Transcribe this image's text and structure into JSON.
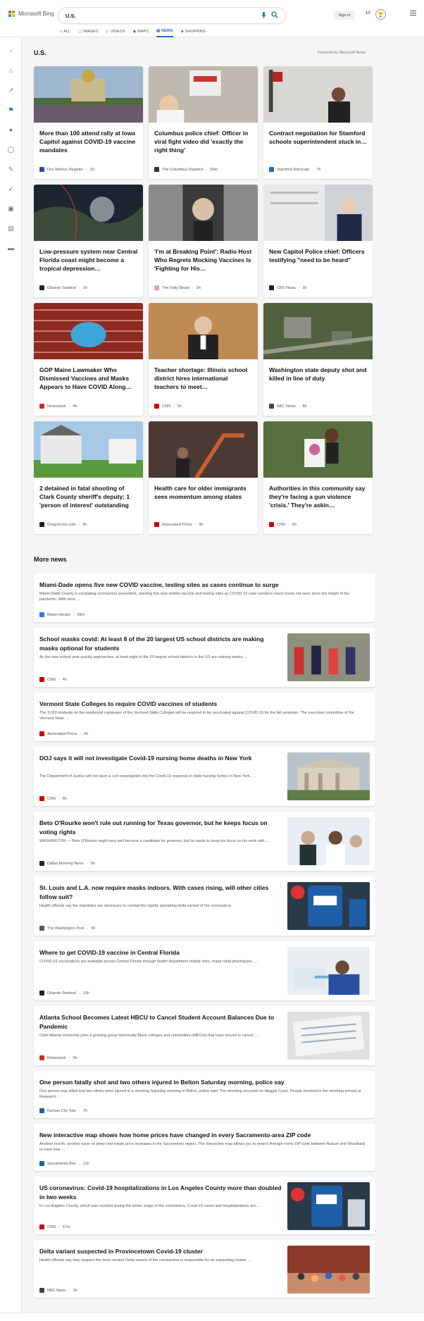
{
  "header": {
    "brand": "Microsoft Bing",
    "search_value": "U.S.",
    "signin_label": "Sign in",
    "points": "10"
  },
  "tabs": [
    {
      "label": "ALL",
      "icon": "search-icon"
    },
    {
      "label": "IMAGES",
      "icon": "image-icon"
    },
    {
      "label": "VIDEOS",
      "icon": "video-icon"
    },
    {
      "label": "MAPS",
      "icon": "map-pin-icon"
    },
    {
      "label": "NEWS",
      "icon": "news-icon",
      "active": true
    },
    {
      "label": "SHOPPING",
      "icon": "tag-icon"
    }
  ],
  "section": {
    "title": "U.S.",
    "powered": "Powered by Microsoft News"
  },
  "cards": [
    {
      "title": "More than 100 attend rally at Iowa Capitol against COVID-19 vaccine mandates",
      "source": "Des Moines Register",
      "time": "1h",
      "badge_color": "#2b4f9e"
    },
    {
      "title": "Columbus police chief: Officer in viral fight video did 'exactly the right thing'",
      "source": "The Columbus Dispatch",
      "time": "56m",
      "badge_color": "#333333"
    },
    {
      "title": "Contract negotiation for Stamford schools superintendent stuck in…",
      "source": "Stamford Advocate",
      "time": "7h",
      "badge_color": "#1f6fb5"
    },
    {
      "title": "Low-pressure system near Central Florida coast might become a tropical depression…",
      "source": "Orlando Sentinel",
      "time": "1h",
      "badge_color": "#222222"
    },
    {
      "title": "'I'm at Breaking Point': Radio Host Who Regrets Mocking Vaccines Is 'Fighting for His…",
      "source": "The Daily Beast",
      "time": "3h",
      "badge_color": "#e8a0b0"
    },
    {
      "title": "New Capitol Police chief: Officers testifying \"need to be heard\"",
      "source": "CBS News",
      "time": "3h",
      "badge_color": "#222222"
    },
    {
      "title": "GOP Maine Lawmaker Who Dismissed Vaccines and Masks Appears to Have COVID Along…",
      "source": "Newsweek",
      "time": "4h",
      "badge_color": "#d42b2b"
    },
    {
      "title": "Teacher shortage: Illinois school district hires international teachers to meet…",
      "source": "CNN",
      "time": "5h",
      "badge_color": "#cc0000"
    },
    {
      "title": "Washington state deputy shot and killed in line of duty",
      "source": "ABC News",
      "time": "8h",
      "badge_color": "#444444"
    },
    {
      "title": "2 detained in fatal shooting of Clark County sheriff's deputy; 1 'person of interest' outstanding",
      "source": "OregonLive.com",
      "time": "3h",
      "badge_color": "#222222"
    },
    {
      "title": "Health care for older immigrants sees momentum among states",
      "source": "Associated Press",
      "time": "9h",
      "badge_color": "#cc0000"
    },
    {
      "title": "Authorities in this community say they're facing a gun violence 'crisis.' They're askin…",
      "source": "CNN",
      "time": "9h",
      "badge_color": "#cc0000"
    }
  ],
  "more_news_title": "More news",
  "more_news": [
    {
      "title": "Miami-Dade opens five new COVID vaccine, testing sites as cases continue to surge",
      "snippet": "Miami-Dade County is escalating coronavirus prevention, opening five new mobile vaccine and testing sites as COVID-19 case numbers reach levels not seen since the height of the pandemic. With virus …",
      "source": "Miami Herald",
      "time": "28m",
      "badge_color": "#2b7bd6",
      "has_thumb": false
    },
    {
      "title": "School masks covid: At least 8 of the 20 largest US school districts are making masks optional for students",
      "snippet": "As the new school year quickly approaches, at least eight of the 20 largest school districts in the US are making masks …",
      "source": "CNN",
      "time": "4h",
      "badge_color": "#cc0000",
      "has_thumb": true
    },
    {
      "title": "Vermont State Colleges to require COVID vaccines of students",
      "snippet": "The 3,000 students on the residential campuses of the Vermont State Colleges will be required to be vaccinated against COVID-19 for the fall semester. The executive committee of the Vermont State …",
      "source": "Associated Press",
      "time": "5h",
      "badge_color": "#cc0000",
      "has_thumb": false
    },
    {
      "title": "DOJ says it will not investigate Covid-19 nursing home deaths in New York",
      "snippet": "The Department of Justice will not open a civil investigation into the Covid-19 response in state nursing homes in New York, …",
      "source": "CNN",
      "time": "8h",
      "badge_color": "#cc0000",
      "has_thumb": true
    },
    {
      "title": "Beto O'Rourke won't rule out running for Texas governor, but he keeps focus on voting rights",
      "snippet": "WASHINGTON — Beto O'Rourke might very well become a candidate for governor, but he wants to keep his focus on his work with …",
      "source": "Dallas Morning News",
      "time": "6h",
      "badge_color": "#222222",
      "has_thumb": true
    },
    {
      "title": "St. Louis and L.A. now require masks indoors. With cases rising, will other cities follow suit?",
      "snippet": "Health officials say the mandates are necessary to combat the rapidly spreading delta variant of the coronavirus.",
      "source": "The Washington Post",
      "time": "5h",
      "badge_color": "#555555",
      "has_thumb": true
    },
    {
      "title": "Where to get COVID-19 vaccine in Central Florida",
      "snippet": "COVID-19 vaccinations are available across Central Florida through health department mobile sites, major retail pharmacies, …",
      "source": "Orlando Sentinel",
      "time": "10h",
      "badge_color": "#222222",
      "has_thumb": true
    },
    {
      "title": "Atlanta School Becomes Latest HBCU to Cancel Student Account Balances Due to Pandemic",
      "snippet": "Clark Atlanta University joins a growing group historically Black colleges and universities (HBCUs) that have moved to cancel …",
      "source": "Newsweek",
      "time": "5h",
      "badge_color": "#d42b2b",
      "has_thumb": true
    },
    {
      "title": "One person fatally shot and two others injured in Belton Saturday morning, police say",
      "snippet": "One person was killed and two others were injured in a shooting Saturday morning in Belton, police said. The shooting occurred on Maggie Court. People involved in the shooting arrived at Research …",
      "source": "Kansas City Star",
      "time": "7h",
      "badge_color": "#1f5fa8",
      "has_thumb": false
    },
    {
      "title": "New interactive map shows how home prices have changed in every Sacramento-area ZIP code",
      "snippet": "Another month, another wave of steep real estate price increases in the Sacramento region. This interactive map allows you to search through every ZIP code between Auburn and Woodland to track how …",
      "source": "Sacramento Bee",
      "time": "11h",
      "badge_color": "#1f5fa8",
      "has_thumb": false
    },
    {
      "title": "US coronavirus: Covid-19 hospitalizations in Los Angeles County more than doubled in two weeks",
      "snippet": "In Los Angeles County, which was crushed during the winter surge of the coronavirus, Covid-19 cases and hospitalizations are …",
      "source": "CNN",
      "time": "57m",
      "badge_color": "#cc0000",
      "has_thumb": true
    },
    {
      "title": "Delta variant suspected in Provincetown Covid-19 cluster",
      "snippet": "Health officials say they suspect the more virulent Delta variant of the coronavirus is responsible for an expanding cluster …",
      "source": "NBC News",
      "time": "3h",
      "badge_color": "#444444",
      "has_thumb": true
    }
  ]
}
